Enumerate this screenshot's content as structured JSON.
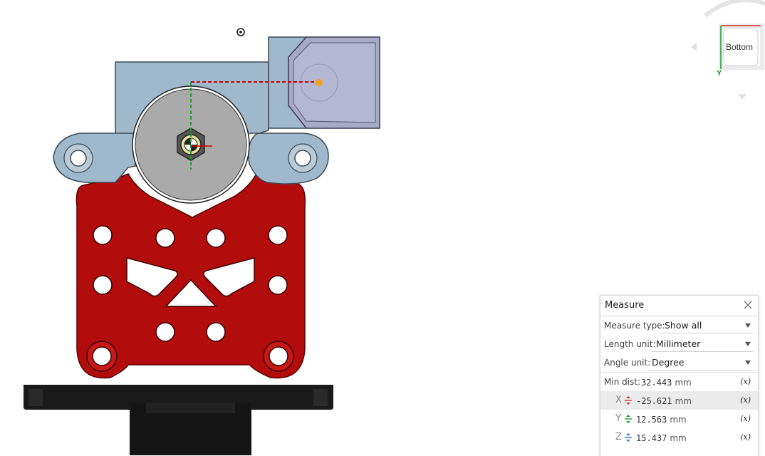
{
  "view_cube": {
    "face_label": "Bottom",
    "axis_label": "Y"
  },
  "measure": {
    "title": "Measure",
    "measure_type": {
      "label": "Measure type:",
      "value": "Show all"
    },
    "length_unit": {
      "label": "Length unit:",
      "value": "Millimeter"
    },
    "angle_unit": {
      "label": "Angle unit:",
      "value": "Degree"
    },
    "min_dist": {
      "label": "Min dist:",
      "value": "32.443",
      "unit": "mm"
    },
    "components": [
      {
        "axis": "X",
        "value": "-25.621",
        "unit": "mm",
        "color": "#d03030"
      },
      {
        "axis": "Y",
        "value": "12.563",
        "unit": "mm",
        "color": "#2a9a3a"
      },
      {
        "axis": "Z",
        "value": "15.437",
        "unit": "mm",
        "color": "#2f6fc9"
      }
    ],
    "fx_label": "(x)"
  },
  "colors": {
    "red_part": "#b30c0c",
    "blue_part": "#9fb8cc",
    "motor": "#1a1a1a",
    "gear": "#aaaaaa",
    "tab": "#a8a9c7"
  }
}
